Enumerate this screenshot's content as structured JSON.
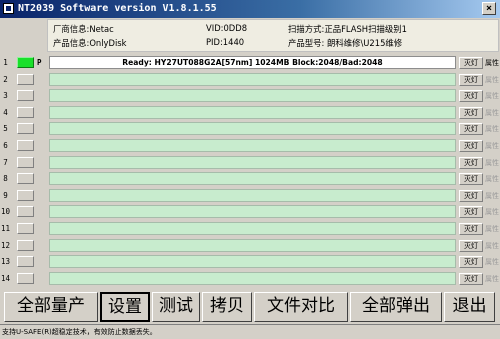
{
  "window": {
    "title": "NT2039 Software version V1.8.1.55",
    "close_glyph": "×"
  },
  "info": {
    "vendor": "厂商信息:Netac",
    "product": "产品信息:OnlyDisk",
    "vid": "VID:0DD8",
    "pid": "PID:1440",
    "scan_mode": "扫描方式:正品FLASH扫描级别1",
    "model": "产品型号: 朗科维修\\U215维修"
  },
  "rows": [
    {
      "num": "1",
      "flag": "P",
      "status": "Ready:  HY27UT088G2A[57nm]  1024MB Block:2048/Bad:2048",
      "light": "灭灯",
      "attr": "属性",
      "active": true
    },
    {
      "num": "2",
      "flag": "",
      "status": "",
      "light": "灭灯",
      "attr": "属性",
      "active": false
    },
    {
      "num": "3",
      "flag": "",
      "status": "",
      "light": "灭灯",
      "attr": "属性",
      "active": false
    },
    {
      "num": "4",
      "flag": "",
      "status": "",
      "light": "灭灯",
      "attr": "属性",
      "active": false
    },
    {
      "num": "5",
      "flag": "",
      "status": "",
      "light": "灭灯",
      "attr": "属性",
      "active": false
    },
    {
      "num": "6",
      "flag": "",
      "status": "",
      "light": "灭灯",
      "attr": "属性",
      "active": false
    },
    {
      "num": "7",
      "flag": "",
      "status": "",
      "light": "灭灯",
      "attr": "属性",
      "active": false
    },
    {
      "num": "8",
      "flag": "",
      "status": "",
      "light": "灭灯",
      "attr": "属性",
      "active": false
    },
    {
      "num": "9",
      "flag": "",
      "status": "",
      "light": "灭灯",
      "attr": "属性",
      "active": false
    },
    {
      "num": "10",
      "flag": "",
      "status": "",
      "light": "灭灯",
      "attr": "属性",
      "active": false
    },
    {
      "num": "11",
      "flag": "",
      "status": "",
      "light": "灭灯",
      "attr": "属性",
      "active": false
    },
    {
      "num": "12",
      "flag": "",
      "status": "",
      "light": "灭灯",
      "attr": "属性",
      "active": false
    },
    {
      "num": "13",
      "flag": "",
      "status": "",
      "light": "灭灯",
      "attr": "属性",
      "active": false
    },
    {
      "num": "14",
      "flag": "",
      "status": "",
      "light": "灭灯",
      "attr": "属性",
      "active": false
    }
  ],
  "toolbar": {
    "mass_produce": "全部量产",
    "settings": "设置",
    "test": "测试",
    "copy": "拷贝",
    "file_compare": "文件对比",
    "eject_all": "全部弹出",
    "exit": "退出"
  },
  "status_bar": "支持U-SAFE(R)超稳定技术，有效防止数据丢失。",
  "colors": {
    "active_indicator": "#19e02a",
    "row_bar": "#c8ecce",
    "titlebar": "#0a246a"
  }
}
